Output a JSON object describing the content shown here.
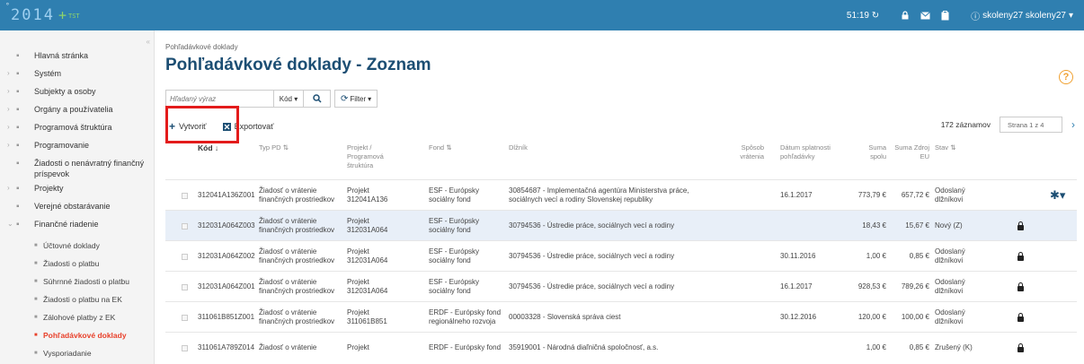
{
  "topbar": {
    "logo_main": "ITMS",
    "logo_year": "2014",
    "logo_plus": "+",
    "logo_tag": "TST",
    "timer": "51:19",
    "user": "skoleny27 skoleny27"
  },
  "sidebar": {
    "items": [
      {
        "label": "Hlavná stránka",
        "icon": "home-icon",
        "caret": ""
      },
      {
        "label": "Systém",
        "icon": "wrench-icon",
        "caret": "›"
      },
      {
        "label": "Subjekty a osoby",
        "icon": "people-icon",
        "caret": "›"
      },
      {
        "label": "Orgány a používatelia",
        "icon": "users-icon",
        "caret": "›"
      },
      {
        "label": "Programová štruktúra",
        "icon": "structure-icon",
        "caret": "›"
      },
      {
        "label": "Programovanie",
        "icon": "gear-icon",
        "caret": "›"
      },
      {
        "label": "Žiadosti o nenávratný finančný príspevok",
        "icon": "request-icon",
        "caret": ""
      },
      {
        "label": "Projekty",
        "icon": "projects-icon",
        "caret": "›"
      },
      {
        "label": "Verejné obstarávanie",
        "icon": "procurement-icon",
        "caret": ""
      },
      {
        "label": "Finančné riadenie",
        "icon": "finance-icon",
        "caret": "⌄"
      }
    ],
    "subitems": [
      {
        "label": "Účtovné doklady",
        "active": false
      },
      {
        "label": "Žiadosti o platbu",
        "active": false
      },
      {
        "label": "Súhrnné žiadosti o platbu",
        "active": false
      },
      {
        "label": "Žiadosti o platbu na EK",
        "active": false
      },
      {
        "label": "Zálohové platby z EK",
        "active": false
      },
      {
        "label": "Pohľadávkové doklady",
        "active": true
      },
      {
        "label": "Vysporiadanie",
        "active": false
      }
    ]
  },
  "main": {
    "breadcrumb": "Pohľadávkové doklady",
    "title": "Pohľadávkové doklady - Zoznam",
    "search_placeholder": "Hľadaný výraz",
    "kod_label": "Kód",
    "filter_label": "Filter",
    "create_label": "Vytvoriť",
    "export_label": "Exportovať",
    "records": "172 záznamov",
    "page": "Strana 1 z 4"
  },
  "table": {
    "headers": {
      "kod": "Kód",
      "typ": "Typ PD",
      "projekt": "Projekt / Programová štruktúra",
      "fond": "Fond",
      "dlznik": "Dlžník",
      "sposob": "Spôsob vrátenia",
      "datum": "Dátum splatnosti pohľadávky",
      "suma": "Suma spolu",
      "suma_eu": "Suma Zdroj EU",
      "stav": "Stav"
    },
    "rows": [
      {
        "kod": "312041A136Z001",
        "typ": "Žiadosť o vrátenie finančných prostriedkov",
        "projekt": "Projekt 312041A136",
        "fond": "ESF - Európsky sociálny fond",
        "dlznik": "30854687 - Implementačná agentúra Ministerstva práce, sociálnych vecí a rodiny Slovenskej republiky",
        "datum": "16.1.2017",
        "suma": "773,79 €",
        "suma_eu": "657,72 €",
        "stav": "Odoslaný dlžníkovi",
        "lock": false,
        "gear": true,
        "highlight": false
      },
      {
        "kod": "312031A064Z003",
        "typ": "Žiadosť o vrátenie finančných prostriedkov",
        "projekt": "Projekt 312031A064",
        "fond": "ESF - Európsky sociálny fond",
        "dlznik": "30794536 - Ústredie práce, sociálnych vecí a rodiny",
        "datum": "",
        "suma": "18,43 €",
        "suma_eu": "15,67 €",
        "stav": "Nový (Z)",
        "lock": true,
        "gear": false,
        "highlight": true
      },
      {
        "kod": "312031A064Z002",
        "typ": "Žiadosť o vrátenie finančných prostriedkov",
        "projekt": "Projekt 312031A064",
        "fond": "ESF - Európsky sociálny fond",
        "dlznik": "30794536 - Ústredie práce, sociálnych vecí a rodiny",
        "datum": "30.11.2016",
        "suma": "1,00 €",
        "suma_eu": "0,85 €",
        "stav": "Odoslaný dlžníkovi",
        "lock": true,
        "gear": false,
        "highlight": false
      },
      {
        "kod": "312031A064Z001",
        "typ": "Žiadosť o vrátenie finančných prostriedkov",
        "projekt": "Projekt 312031A064",
        "fond": "ESF - Európsky sociálny fond",
        "dlznik": "30794536 - Ústredie práce, sociálnych vecí a rodiny",
        "datum": "16.1.2017",
        "suma": "928,53 €",
        "suma_eu": "789,26 €",
        "stav": "Odoslaný dlžníkovi",
        "lock": true,
        "gear": false,
        "highlight": false
      },
      {
        "kod": "311061B851Z001",
        "typ": "Žiadosť o vrátenie finančných prostriedkov",
        "projekt": "Projekt 311061B851",
        "fond": "ERDF - Európsky fond regionálneho rozvoja",
        "dlznik": "00003328 - Slovenská správa ciest",
        "datum": "30.12.2016",
        "suma": "120,00 €",
        "suma_eu": "100,00 €",
        "stav": "Odoslaný dlžníkovi",
        "lock": true,
        "gear": false,
        "highlight": false
      },
      {
        "kod": "311061A789Z014",
        "typ": "Žiadosť o vrátenie",
        "projekt": "Projekt",
        "fond": "ERDF - Európsky fond",
        "dlznik": "35919001 - Národná diaľničná spoločnosť, a.s.",
        "datum": "",
        "suma": "1,00 €",
        "suma_eu": "0,85 €",
        "stav": "Zrušený (K)",
        "lock": true,
        "gear": false,
        "highlight": false
      }
    ]
  }
}
